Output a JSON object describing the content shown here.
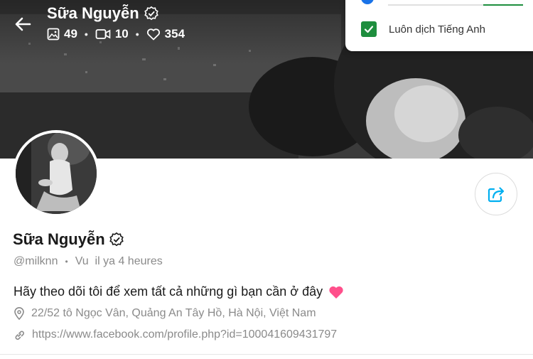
{
  "header": {
    "name": "Sữa Nguyễn",
    "stats": {
      "photos": "49",
      "videos": "10",
      "likes": "354"
    }
  },
  "translate_popup": {
    "checkbox_label": "Luôn dịch Tiếng Anh",
    "checked": true
  },
  "profile": {
    "name": "Sữa Nguyễn",
    "handle": "@milknn",
    "separator": "•",
    "last_seen": "Vu  il ya 4 heures",
    "bio": "Hãy theo dõi tôi để xem tất cả những gì bạn cần ở đây",
    "location": "22/52 tô Ngọc Vân, Quảng An Tây Hồ, Hà Nội, Việt Nam",
    "website": "https://www.facebook.com/profile.php?id=100041609431797"
  },
  "colors": {
    "accent": "#00aff0",
    "heart": "#ff4f8b",
    "checkbox": "#1e8e3e",
    "muted": "#8a8a8a"
  },
  "icons": [
    "back-arrow-icon",
    "verified-icon",
    "image-icon",
    "video-icon",
    "heart-icon",
    "share-icon",
    "location-pin-icon",
    "link-icon",
    "check-icon"
  ]
}
